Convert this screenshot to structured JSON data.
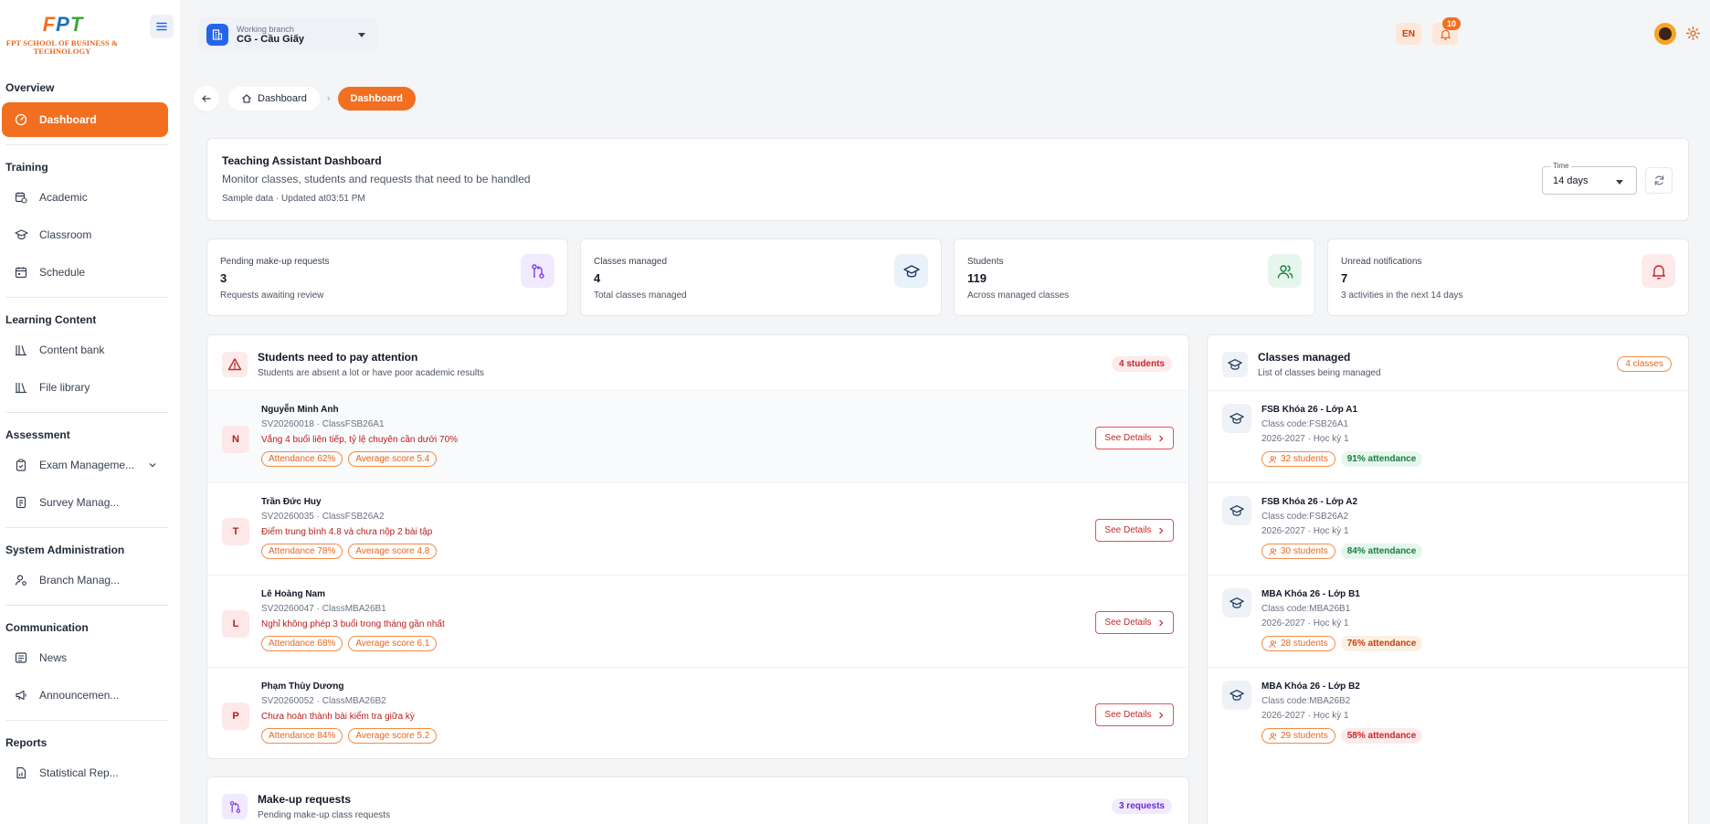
{
  "brand": {
    "logo_mark": "FPT",
    "logo_text": "FPT SCHOOL OF BUSINESS & TECHNOLOGY"
  },
  "colors": {
    "accent": "#f26f21",
    "danger": "#c62828",
    "success": "#15803d",
    "purple": "#7c3aed",
    "blue": "#2563eb"
  },
  "sidebar": {
    "sections": [
      {
        "title": "Overview",
        "items": [
          {
            "label": "Dashboard",
            "icon": "dashboard-icon",
            "active": true
          }
        ]
      },
      {
        "title": "Training",
        "items": [
          {
            "label": "Academic",
            "icon": "calendar-icon"
          },
          {
            "label": "Classroom",
            "icon": "graduation-cap-icon"
          },
          {
            "label": "Schedule",
            "icon": "calendar-icon"
          }
        ]
      },
      {
        "title": "Learning Content",
        "items": [
          {
            "label": "Content bank",
            "icon": "library-icon"
          },
          {
            "label": "File library",
            "icon": "library-icon"
          }
        ]
      },
      {
        "title": "Assessment",
        "items": [
          {
            "label": "Exam Manageme...",
            "icon": "clipboard-check-icon",
            "chevron": true
          },
          {
            "label": "Survey Manag...",
            "icon": "survey-icon"
          }
        ]
      },
      {
        "title": "System Administration",
        "items": [
          {
            "label": "Branch Manag...",
            "icon": "user-icon"
          }
        ]
      },
      {
        "title": "Communication",
        "items": [
          {
            "label": "News",
            "icon": "newspaper-icon"
          },
          {
            "label": "Announcemen...",
            "icon": "megaphone-icon"
          }
        ]
      },
      {
        "title": "Reports",
        "items": [
          {
            "label": "Statistical Rep...",
            "icon": "report-icon"
          }
        ]
      }
    ]
  },
  "topbar": {
    "branch_label": "Working branch",
    "branch_value": "CG - Cầu Giấy",
    "lang": "EN",
    "notif_count": "10"
  },
  "breadcrumb": {
    "home": "Dashboard",
    "current": "Dashboard"
  },
  "header": {
    "title": "Teaching Assistant Dashboard",
    "subtitle": "Monitor classes, students and requests that need to be handled",
    "meta": "Sample data · Updated at03:51 PM",
    "time_label": "Time",
    "time_value": "14 days"
  },
  "stats": [
    {
      "title": "Pending make-up requests",
      "value": "3",
      "sub": "Requests awaiting review",
      "icon": "git-pull-request-icon"
    },
    {
      "title": "Classes managed",
      "value": "4",
      "sub": "Total classes managed",
      "icon": "graduation-cap-icon"
    },
    {
      "title": "Students",
      "value": "119",
      "sub": "Across managed classes",
      "icon": "users-icon"
    },
    {
      "title": "Unread notifications",
      "value": "7",
      "sub": "3 activities in the next 14 days",
      "icon": "bell-icon"
    }
  ],
  "attention": {
    "title": "Students need to pay attention",
    "subtitle": "Students are absent a lot or have poor academic results",
    "badge": "4 students",
    "details_label": "See Details",
    "students": [
      {
        "initial": "N",
        "name": "Nguyễn Minh Anh",
        "code": "SV20260018 · ClassFSB26A1",
        "warning": "Vắng 4 buổi liên tiếp, tỷ lệ chuyên cần dưới 70%",
        "attendance": "Attendance 62%",
        "score": "Average score 5.4"
      },
      {
        "initial": "T",
        "name": "Trần Đức Huy",
        "code": "SV20260035 · ClassFSB26A2",
        "warning": "Điểm trung bình 4.8 và chưa nộp 2 bài tập",
        "attendance": "Attendance 78%",
        "score": "Average score 4.8"
      },
      {
        "initial": "L",
        "name": "Lê Hoàng Nam",
        "code": "SV20260047 · ClassMBA26B1",
        "warning": "Nghỉ không phép 3 buổi trong tháng gần nhất",
        "attendance": "Attendance 68%",
        "score": "Average score 6.1"
      },
      {
        "initial": "P",
        "name": "Phạm Thùy Dương",
        "code": "SV20260052 · ClassMBA26B2",
        "warning": "Chưa hoàn thành bài kiểm tra giữa kỳ",
        "attendance": "Attendance 84%",
        "score": "Average score 5.2"
      }
    ]
  },
  "classes": {
    "title": "Classes managed",
    "subtitle": "List of classes being managed",
    "badge": "4 classes",
    "items": [
      {
        "name": "FSB Khóa 26 - Lớp A1",
        "code": "Class code:FSB26A1",
        "year": "2026-2027 · Học kỳ 1",
        "students": "32 students",
        "attendance": "91% attendance",
        "level": "good"
      },
      {
        "name": "FSB Khóa 26 - Lớp A2",
        "code": "Class code:FSB26A2",
        "year": "2026-2027 · Học kỳ 1",
        "students": "30 students",
        "attendance": "84% attendance",
        "level": "good"
      },
      {
        "name": "MBA Khóa 26 - Lớp B1",
        "code": "Class code:MBA26B1",
        "year": "2026-2027 · Học kỳ 1",
        "students": "28 students",
        "attendance": "76% attendance",
        "level": "warn"
      },
      {
        "name": "MBA Khóa 26 - Lớp B2",
        "code": "Class code:MBA26B2",
        "year": "2026-2027 · Học kỳ 1",
        "students": "29 students",
        "attendance": "58% attendance",
        "level": "bad"
      }
    ]
  },
  "makeup": {
    "title": "Make-up requests",
    "subtitle": "Pending make-up class requests",
    "badge": "3 requests"
  }
}
